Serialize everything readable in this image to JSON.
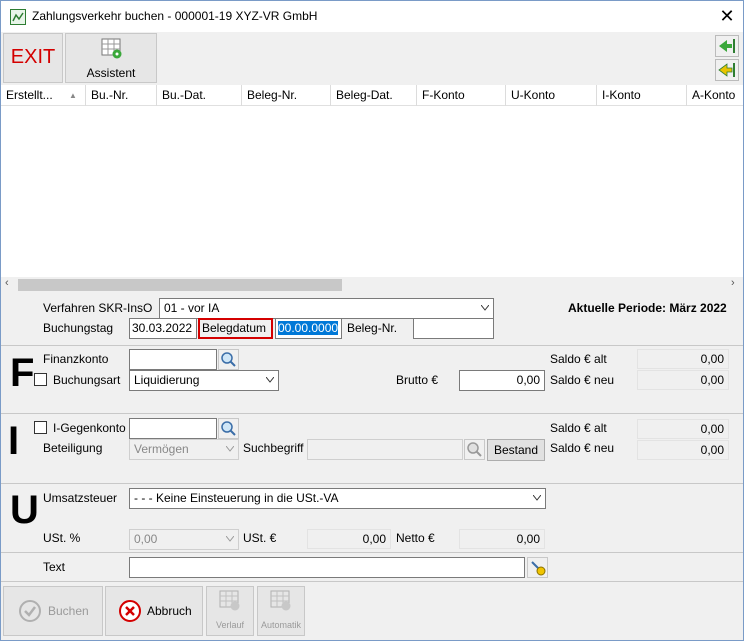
{
  "window": {
    "title": "Zahlungsverkehr buchen - 000001-19 XYZ-VR GmbH"
  },
  "toolbar": {
    "exit_label": "EXIT",
    "assistent_label": "Assistent"
  },
  "grid": {
    "columns": [
      "Erstellt...",
      "Bu.-Nr.",
      "Bu.-Dat.",
      "Beleg-Nr.",
      "Beleg-Dat.",
      "F-Konto",
      "U-Konto",
      "I-Konto",
      "A-Konto"
    ]
  },
  "header_form": {
    "verfahren_label": "Verfahren SKR-InsO",
    "verfahren_value": "01 - vor IA",
    "buchungstag_label": "Buchungstag",
    "buchungstag_value": "30.03.2022",
    "belegdatum_label": "Belegdatum",
    "belegdatum_value": "00.00.0000",
    "belegnr_label": "Beleg-Nr.",
    "belegnr_value": "",
    "periode_text": "Aktuelle Periode: März 2022"
  },
  "section_f": {
    "letter": "F",
    "finanzkonto_label": "Finanzkonto",
    "finanzkonto_value": "",
    "buchungsart_label": "Buchungsart",
    "buchungsart_value": "Liquidierung",
    "brutto_label": "Brutto €",
    "brutto_value": "0,00",
    "saldo_alt_label": "Saldo € alt",
    "saldo_alt_value": "0,00",
    "saldo_neu_label": "Saldo € neu",
    "saldo_neu_value": "0,00"
  },
  "section_i": {
    "letter": "I",
    "gegenkonto_label": "I-Gegenkonto",
    "gegenkonto_value": "",
    "beteiligung_label": "Beteiligung",
    "beteiligung_value": "Vermögen",
    "suchbegriff_label": "Suchbegriff",
    "suchbegriff_value": "",
    "bestand_label": "Bestand",
    "saldo_alt_label": "Saldo € alt",
    "saldo_alt_value": "0,00",
    "saldo_neu_label": "Saldo € neu",
    "saldo_neu_value": "0,00"
  },
  "section_u": {
    "letter": "U",
    "umsatzsteuer_label": "Umsatzsteuer",
    "umsatzsteuer_value": "- - - Keine Einsteuerung in die USt.-VA",
    "ust_pct_label": "USt. %",
    "ust_pct_value": "0,00",
    "ust_eur_label": "USt. €",
    "ust_eur_value": "0,00",
    "netto_label": "Netto €",
    "netto_value": "0,00"
  },
  "text_row": {
    "label": "Text",
    "value": ""
  },
  "bottom": {
    "buchen_label": "Buchen",
    "abbruch_label": "Abbruch",
    "verlauf_label": "Verlauf",
    "automatik_label": "Automatik"
  },
  "colors": {
    "exit": "#d40000",
    "belegdatum_border": "#d40000",
    "selection": "#0078d7"
  }
}
